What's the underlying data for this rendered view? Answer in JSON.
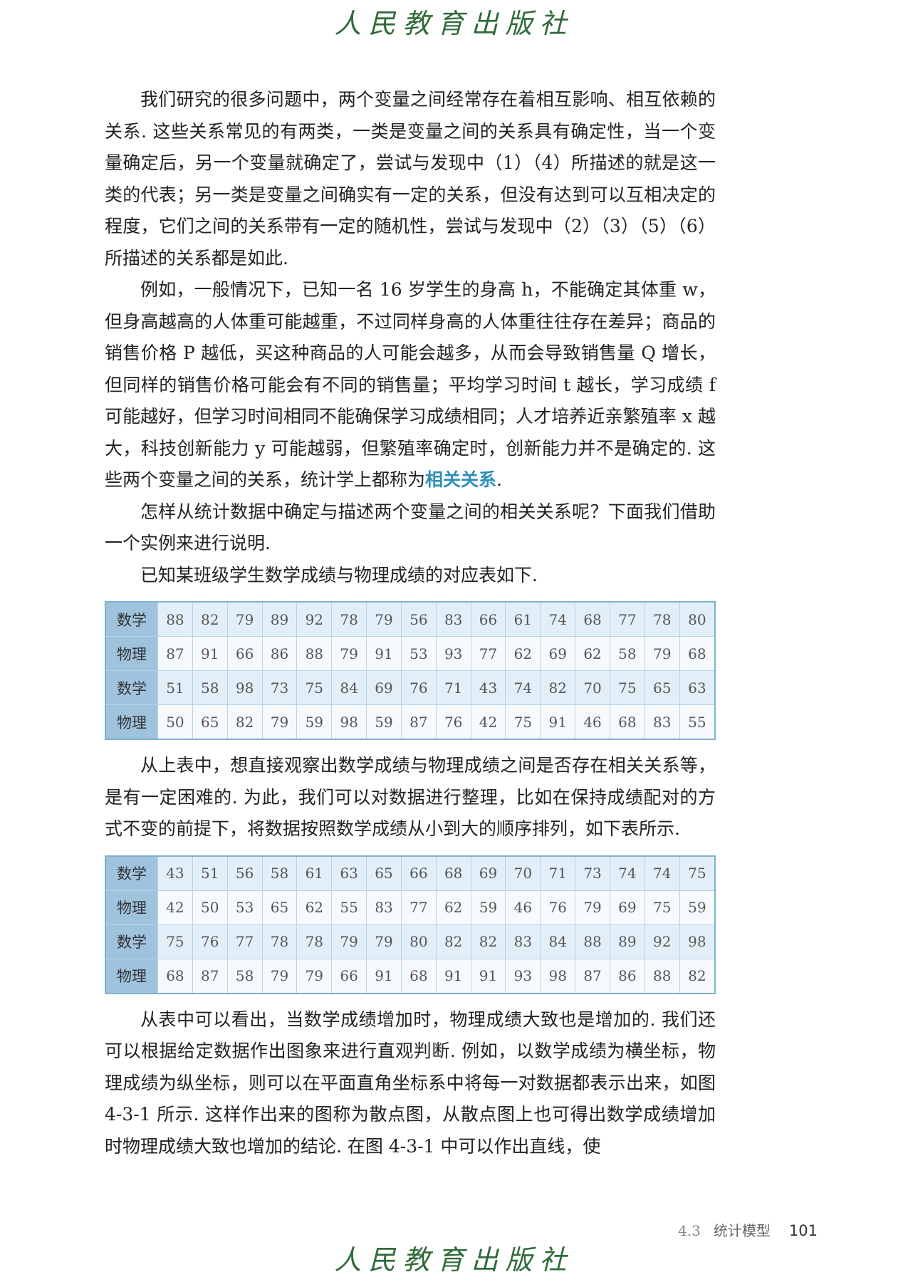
{
  "publisher": "人民教育出版社",
  "paragraphs": {
    "p1": "我们研究的很多问题中，两个变量之间经常存在着相互影响、相互依赖的关系. 这些关系常见的有两类，一类是变量之间的关系具有确定性，当一个变量确定后，另一个变量就确定了，尝试与发现中（1）（4）所描述的就是这一类的代表；另一类是变量之间确实有一定的关系，但没有达到可以互相决定的程度，它们之间的关系带有一定的随机性，尝试与发现中（2）（3）（5）（6）所描述的关系都是如此.",
    "p2_before": "例如，一般情况下，已知一名 16 岁学生的身高 h，不能确定其体重 w，但身高越高的人体重可能越重，不过同样身高的人体重往往存在差异；商品的销售价格 P 越低，买这种商品的人可能会越多，从而会导致销售量 Q 增长，但同样的销售价格可能会有不同的销售量；平均学习时间 t 越长，学习成绩 f 可能越好，但学习时间相同不能确保学习成绩相同；人才培养近亲繁殖率 x 越大，科技创新能力 y 可能越弱，但繁殖率确定时，创新能力并不是确定的. 这些两个变量之间的关系，统计学上都称为",
    "p2_term": "相关关系",
    "p2_after": ".",
    "p3": "怎样从统计数据中确定与描述两个变量之间的相关关系呢？下面我们借助一个实例来进行说明.",
    "p4": "已知某班级学生数学成绩与物理成绩的对应表如下.",
    "p5": "从上表中，想直接观察出数学成绩与物理成绩之间是否存在相关关系等，是有一定困难的. 为此，我们可以对数据进行整理，比如在保持成绩配对的方式不变的前提下，将数据按照数学成绩从小到大的顺序排列，如下表所示.",
    "p6": "从表中可以看出，当数学成绩增加时，物理成绩大致也是增加的. 我们还可以根据给定数据作出图象来进行直观判断. 例如，以数学成绩为横坐标，物理成绩为纵坐标，则可以在平面直角坐标系中将每一对数据都表示出来，如图 4-3-1 所示. 这样作出来的图称为散点图，从散点图上也可得出数学成绩增加时物理成绩大致也增加的结论. 在图 4-3-1 中可以作出直线，使"
  },
  "table1": [
    {
      "head": "数学",
      "values": [
        "88",
        "82",
        "79",
        "89",
        "92",
        "78",
        "79",
        "56",
        "83",
        "66",
        "61",
        "74",
        "68",
        "77",
        "78",
        "80"
      ]
    },
    {
      "head": "物理",
      "values": [
        "87",
        "91",
        "66",
        "86",
        "88",
        "79",
        "91",
        "53",
        "93",
        "77",
        "62",
        "69",
        "62",
        "58",
        "79",
        "68"
      ]
    },
    {
      "head": "数学",
      "values": [
        "51",
        "58",
        "98",
        "73",
        "75",
        "84",
        "69",
        "76",
        "71",
        "43",
        "74",
        "82",
        "70",
        "75",
        "65",
        "63"
      ]
    },
    {
      "head": "物理",
      "values": [
        "50",
        "65",
        "82",
        "79",
        "59",
        "98",
        "59",
        "87",
        "76",
        "42",
        "75",
        "91",
        "46",
        "68",
        "83",
        "55"
      ]
    }
  ],
  "table2": [
    {
      "head": "数学",
      "values": [
        "43",
        "51",
        "56",
        "58",
        "61",
        "63",
        "65",
        "66",
        "68",
        "69",
        "70",
        "71",
        "73",
        "74",
        "74",
        "75"
      ]
    },
    {
      "head": "物理",
      "values": [
        "42",
        "50",
        "53",
        "65",
        "62",
        "55",
        "83",
        "77",
        "62",
        "59",
        "46",
        "76",
        "79",
        "69",
        "75",
        "59"
      ]
    },
    {
      "head": "数学",
      "values": [
        "75",
        "76",
        "77",
        "78",
        "78",
        "79",
        "79",
        "80",
        "82",
        "82",
        "83",
        "84",
        "88",
        "89",
        "92",
        "98"
      ]
    },
    {
      "head": "物理",
      "values": [
        "68",
        "87",
        "58",
        "79",
        "79",
        "66",
        "91",
        "68",
        "91",
        "91",
        "93",
        "98",
        "87",
        "86",
        "88",
        "82"
      ]
    }
  ],
  "footer": {
    "section": "4.3",
    "section_title": "统计模型",
    "page_number": "101"
  }
}
